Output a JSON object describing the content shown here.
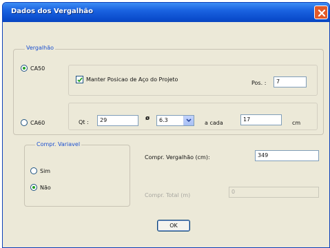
{
  "window": {
    "title": "Dados dos Vergalhão"
  },
  "vergalhao": {
    "legend": "Vergalhão",
    "ca50_label": "CA50",
    "ca60_label": "CA60",
    "selected": "CA50",
    "manter_label": "Manter Posicao de Aço do Projeto",
    "manter_checked": true,
    "pos_label": "Pos. :",
    "pos_value": "7",
    "qt_label": "Qt :",
    "qt_value": "29",
    "diameter_symbol": "ø",
    "diameter_value": "6.3",
    "a_cada_label": "a cada",
    "a_cada_value": "17",
    "unit_label": "cm"
  },
  "compr_variavel": {
    "legend": "Compr. Variavel",
    "sim_label": "Sim",
    "nao_label": "Não",
    "selected": "Não"
  },
  "compr": {
    "vergalhao_label": "Compr. Vergalhão (cm):",
    "vergalhao_value": "349",
    "total_label": "Compr. Total (m)",
    "total_value": "0"
  },
  "buttons": {
    "ok": "OK"
  }
}
